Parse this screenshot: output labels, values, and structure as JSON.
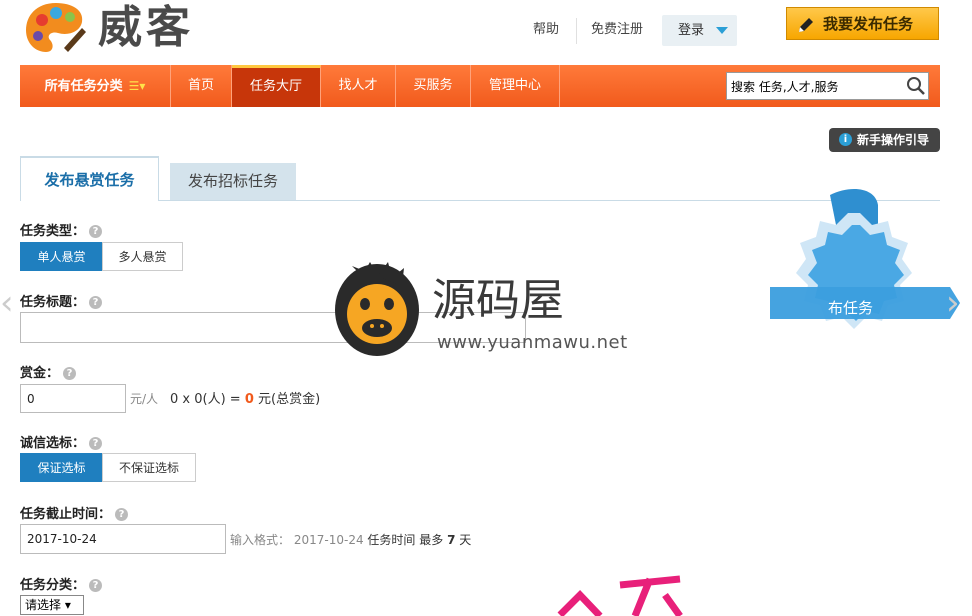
{
  "header": {
    "logo_text": "威客",
    "links": {
      "help": "帮助",
      "register": "免费注册",
      "login": "登录"
    },
    "publish_label": "我要发布任务"
  },
  "nav": {
    "all_label": "所有任务分类",
    "items": [
      "首页",
      "任务大厅",
      "找人才",
      "买服务",
      "管理中心"
    ],
    "active_index": 1,
    "search_placeholder": "搜索 任务,人才,服务"
  },
  "guide_label": "新手操作引导",
  "tabs": [
    "发布悬赏任务",
    "发布招标任务"
  ],
  "banner_text": "布任务",
  "form": {
    "type_label": "任务类型：",
    "type_options": [
      "单人悬赏",
      "多人悬赏"
    ],
    "title_label": "任务标题：",
    "reward_label": "赏金：",
    "reward_value": "0",
    "reward_unit": "元/人",
    "reward_calc_prefix": "0 x 0(人) =",
    "reward_total": "0",
    "reward_total_suffix": "元(总赏金)",
    "credit_label": "诚信选标：",
    "credit_options": [
      "保证选标",
      "不保证选标"
    ],
    "deadline_label": "任务截止时间：",
    "deadline_value": "2017-10-24",
    "deadline_hint_prefix": "输入格式：",
    "deadline_hint_date": "2017-10-24",
    "deadline_hint_mid": "任务时间 最多",
    "deadline_hint_days": "7",
    "deadline_hint_unit": "天",
    "category_label": "任务分类：",
    "category_value": "请选择"
  },
  "watermark": {
    "name": "源码屋",
    "url": "www.yuanmawu.net"
  },
  "colors": {
    "nav_orange": "#f15a1c",
    "active_tab": "#c7360a",
    "primary_blue": "#1f7fbf",
    "publish_yellow": "#f7a600"
  }
}
